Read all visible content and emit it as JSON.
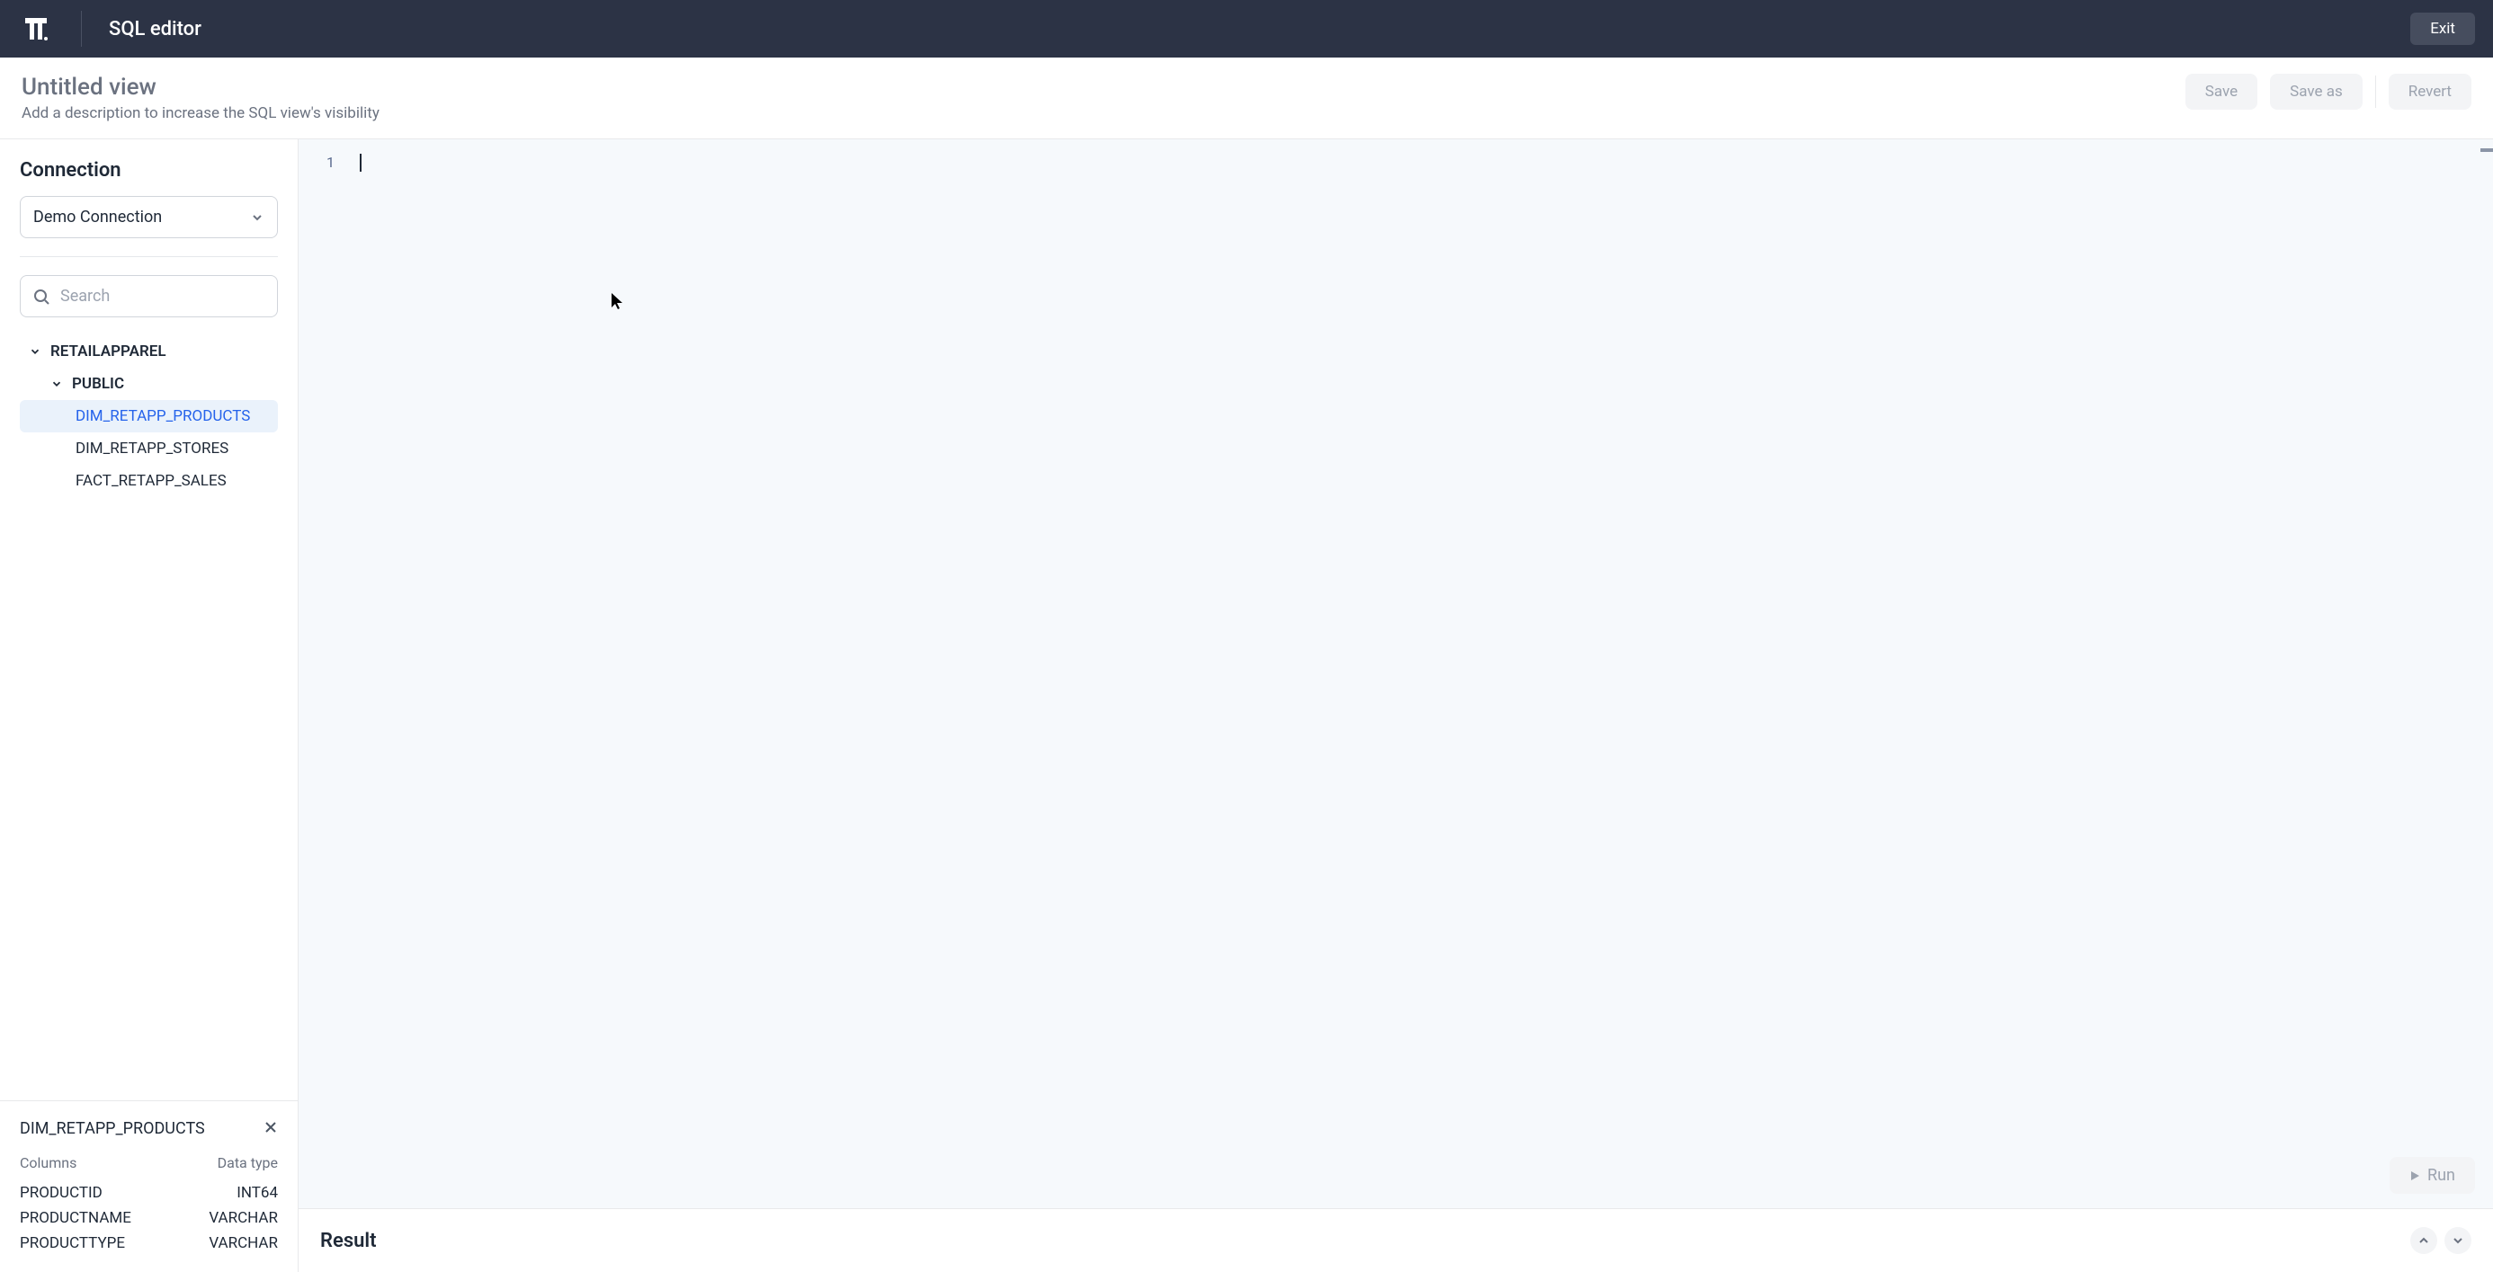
{
  "header": {
    "title": "SQL editor",
    "exit_label": "Exit"
  },
  "view": {
    "title": "Untitled view",
    "description": "Add a description to increase the SQL view's visibility"
  },
  "actions": {
    "save": "Save",
    "save_as": "Save as",
    "revert": "Revert",
    "run": "Run"
  },
  "sidebar": {
    "connection_label": "Connection",
    "connection_selected": "Demo Connection",
    "search_placeholder": "Search",
    "tree": {
      "database": "RETAILAPPAREL",
      "schema": "PUBLIC",
      "tables": [
        "DIM_RETAPP_PRODUCTS",
        "DIM_RETAPP_STORES",
        "FACT_RETAPP_SALES"
      ]
    }
  },
  "detail": {
    "table_name": "DIM_RETAPP_PRODUCTS",
    "columns_label": "Columns",
    "datatype_label": "Data type",
    "columns": [
      {
        "name": "PRODUCTID",
        "type": "INT64"
      },
      {
        "name": "PRODUCTNAME",
        "type": "VARCHAR"
      },
      {
        "name": "PRODUCTTYPE",
        "type": "VARCHAR"
      }
    ]
  },
  "editor": {
    "line_number": "1"
  },
  "result": {
    "title": "Result"
  }
}
